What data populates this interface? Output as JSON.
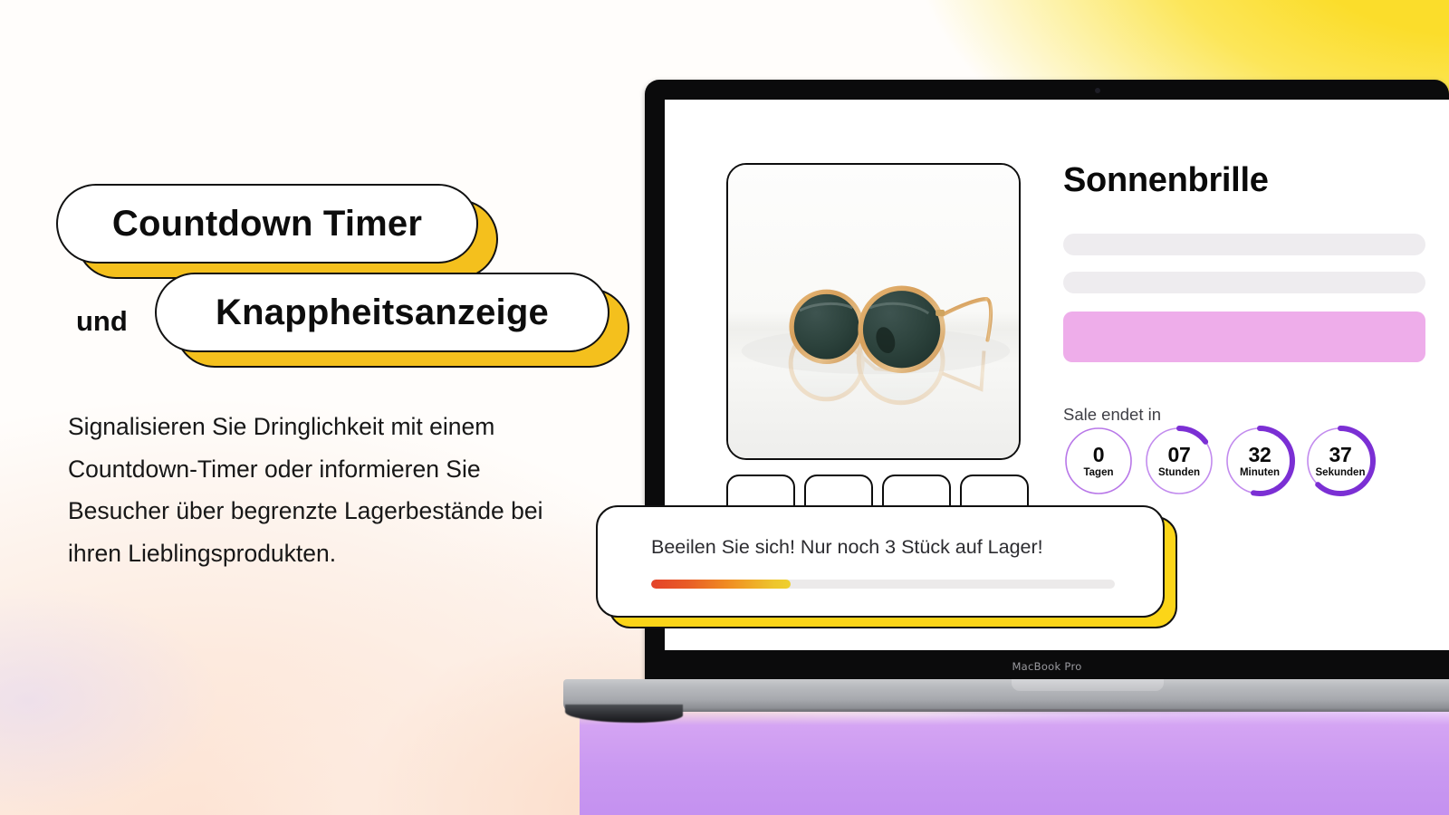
{
  "background": {
    "yellow": "#fbdd2b",
    "peach": "#fde3d3",
    "purple": "#c896f2",
    "accent_yellow": "#f4c01d",
    "accent_purple": "#7b2fd4",
    "cta_pink": "#eeadea"
  },
  "headline": {
    "pill_one": "Countdown Timer",
    "connector": "und",
    "pill_two": "Knappheitsanzeige"
  },
  "body": {
    "paragraph": "Signalisieren Sie Dringlichkeit mit einem Countdown-Timer oder informieren Sie Besucher über begrenzte Lagerbestände bei ihren Lieblingsprodukten."
  },
  "laptop": {
    "model_label": "MacBook Pro"
  },
  "product": {
    "title": "Sonnenbrille",
    "image_alt": "round gold-frame sunglasses with dark green lenses",
    "thumbnail_count": 4
  },
  "countdown": {
    "label": "Sale endet in",
    "items": [
      {
        "value": "0",
        "unit": "Tagen",
        "percent": 0
      },
      {
        "value": "07",
        "unit": "Stunden",
        "percent": 15
      },
      {
        "value": "32",
        "unit": "Minuten",
        "percent": 53
      },
      {
        "value": "37",
        "unit": "Sekunden",
        "percent": 62
      }
    ]
  },
  "stock_notice": {
    "message": "Beeilen Sie sich! Nur noch 3 Stück auf Lager!",
    "bar_percent": 30,
    "bar_gradient_start": "#e4432a",
    "bar_gradient_end": "#eed02e"
  }
}
